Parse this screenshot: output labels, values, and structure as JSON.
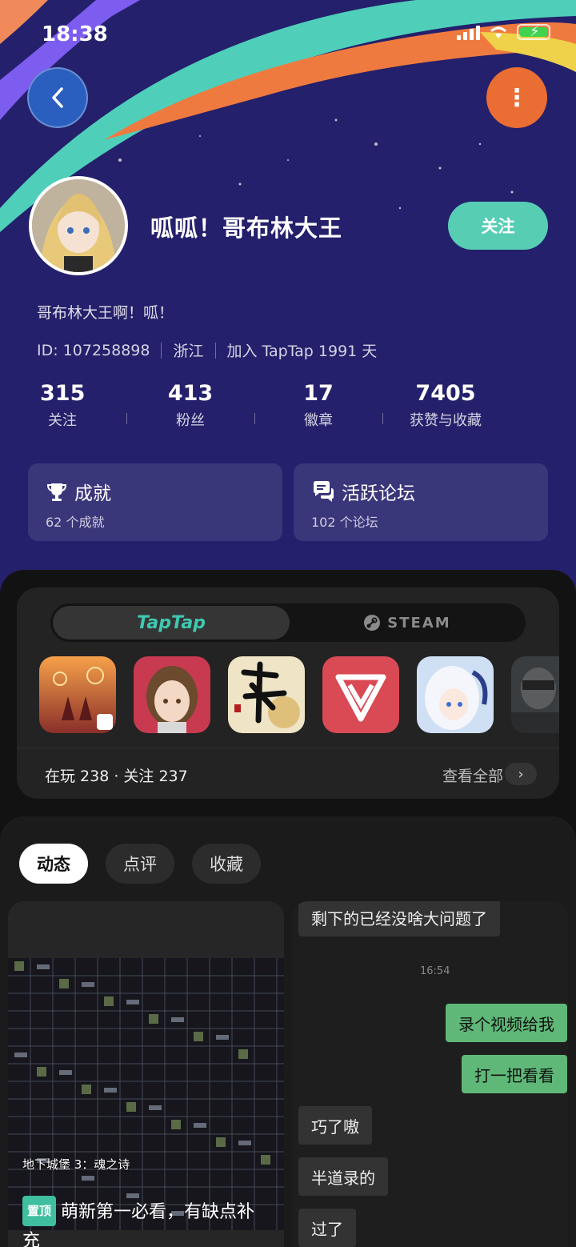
{
  "status_bar": {
    "time": "18:38"
  },
  "profile": {
    "name": "呱呱！哥布林大王",
    "follow_label": "关注",
    "bio": "哥布林大王啊！呱！",
    "id_text": "ID: 107258898",
    "region": "浙江",
    "joined": "加入 TapTap 1991 天"
  },
  "stats": [
    {
      "value": "315",
      "label": "关注"
    },
    {
      "value": "413",
      "label": "粉丝"
    },
    {
      "value": "17",
      "label": "徽章"
    },
    {
      "value": "7405",
      "label": "获赞与收藏"
    }
  ],
  "cards": {
    "achievements": {
      "title": "成就",
      "sub": "62 个成就"
    },
    "forums": {
      "title": "活跃论坛",
      "sub": "102 个论坛"
    }
  },
  "games": {
    "tab_taptap": "TapTap",
    "tab_steam": "STEAM",
    "count_text": "在玩 238 · 关注 237",
    "view_all": "查看全部"
  },
  "feed": {
    "tabs": [
      "动态",
      "点评",
      "收藏"
    ],
    "post": {
      "image_caption": "地下城堡 3：魂之诗",
      "pin_label": "置顶",
      "title": "萌新第一必看，有缺点补充"
    },
    "chat": {
      "messages": [
        {
          "text": "剩下的已经没啥大问题了",
          "dir": "in"
        },
        {
          "text": "录个视频给我",
          "dir": "out"
        },
        {
          "text": "打一把看看",
          "dir": "out"
        },
        {
          "text": "巧了嗷",
          "dir": "in"
        },
        {
          "text": "半道录的",
          "dir": "in"
        },
        {
          "text": "过了",
          "dir": "in"
        }
      ],
      "time": "16:54"
    }
  },
  "colors": {
    "header_bg": "#24206b",
    "accent_teal": "#57cdb4",
    "accent_orange": "#ea6d34",
    "chat_out": "#5fb878"
  }
}
